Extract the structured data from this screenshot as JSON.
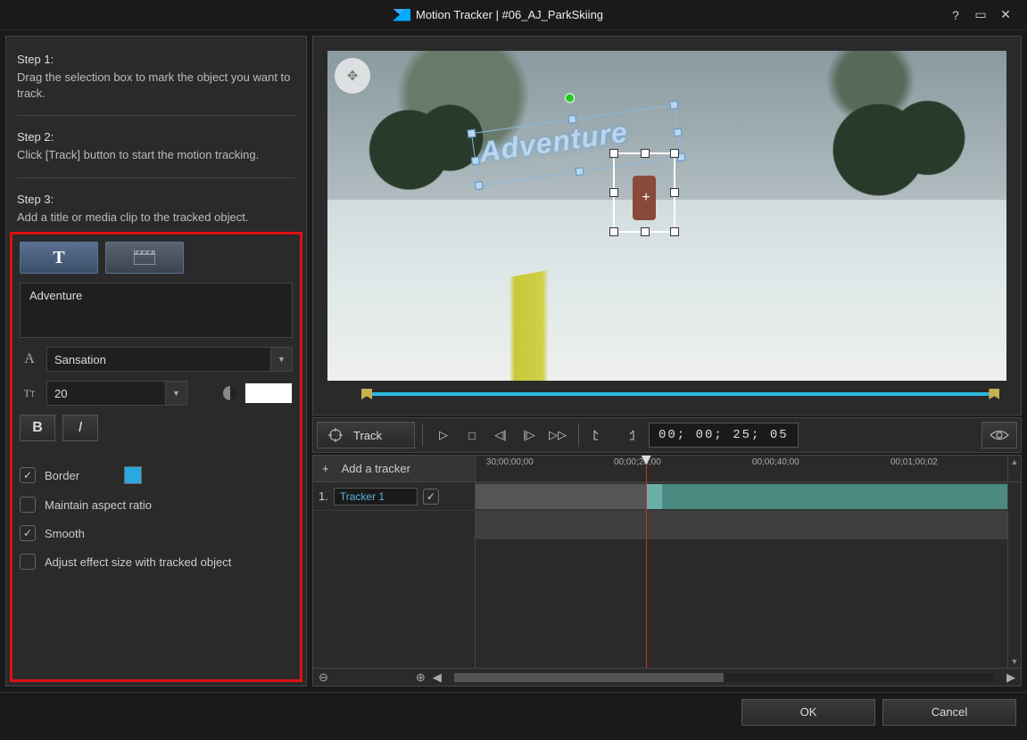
{
  "window": {
    "title": "Motion Tracker  |  #06_AJ_ParkSkiing"
  },
  "steps": {
    "s1_label": "Step 1:",
    "s1_text": "Drag the selection box to mark the object you want to track.",
    "s2_label": "Step 2:",
    "s2_text": "Click [Track] button to start the motion tracking.",
    "s3_label": "Step 3:",
    "s3_text": "Add a title or media clip to the tracked object."
  },
  "title_panel": {
    "text_value": "Adventure",
    "font_family": "Sansation",
    "font_size": "20",
    "bold_label": "B",
    "italic_label": "I",
    "border_label": "Border",
    "border_checked": true,
    "border_color": "#2aa8e0",
    "aspect_label": "Maintain aspect ratio",
    "aspect_checked": false,
    "smooth_label": "Smooth",
    "smooth_checked": true,
    "adjust_label": "Adjust effect size with tracked object",
    "adjust_checked": false
  },
  "preview": {
    "overlay_text": "Adventure"
  },
  "transport": {
    "track_label": "Track",
    "timecode": "00; 00; 25; 05"
  },
  "timeline": {
    "add_tracker_label": "Add a tracker",
    "ticks": [
      "30;00;00;00",
      "00;00;20;00",
      "00;00;40;00",
      "00;01;00;02"
    ],
    "tracker_index": "1.",
    "tracker_name": "Tracker 1"
  },
  "footer": {
    "ok": "OK",
    "cancel": "Cancel"
  }
}
